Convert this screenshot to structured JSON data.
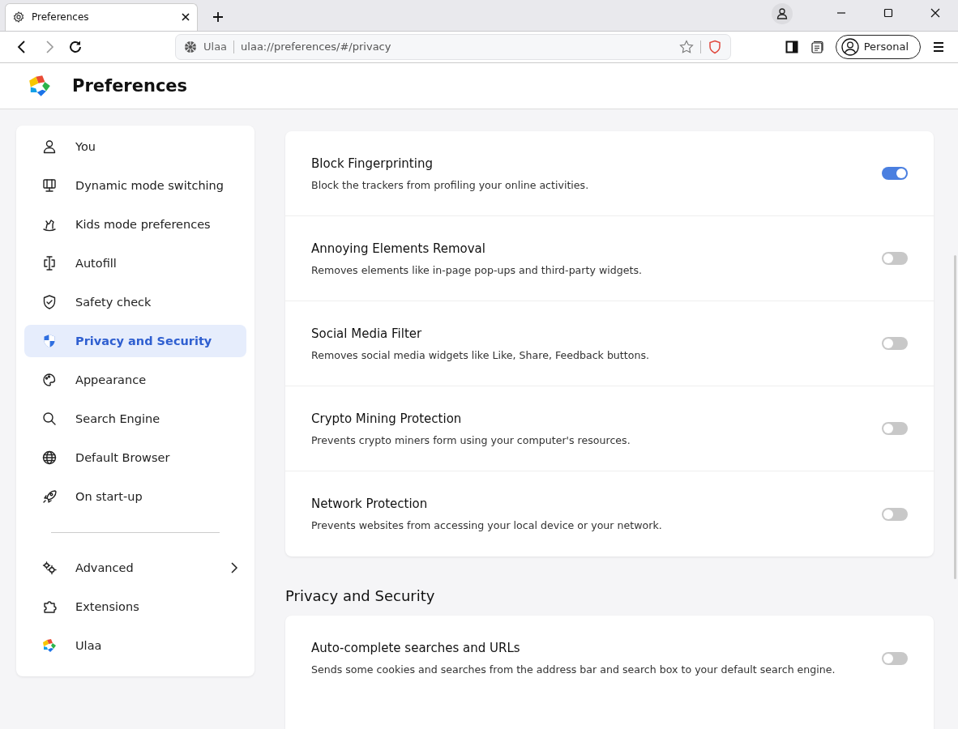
{
  "tab": {
    "title": "Preferences",
    "selected": true
  },
  "address_bar": {
    "site_label": "Ulaa",
    "url": "ulaa://preferences/#/privacy"
  },
  "profile_button": {
    "label": "Personal"
  },
  "header": {
    "title": "Preferences"
  },
  "sidebar": {
    "items": [
      {
        "label": "You",
        "selected": false,
        "has_submenu": false
      },
      {
        "label": "Dynamic mode switching",
        "selected": false,
        "has_submenu": false
      },
      {
        "label": "Kids mode preferences",
        "selected": false,
        "has_submenu": false
      },
      {
        "label": "Autofill",
        "selected": false,
        "has_submenu": false
      },
      {
        "label": "Safety check",
        "selected": false,
        "has_submenu": false
      },
      {
        "label": "Privacy and Security",
        "selected": true,
        "has_submenu": false
      },
      {
        "label": "Appearance",
        "selected": false,
        "has_submenu": false
      },
      {
        "label": "Search Engine",
        "selected": false,
        "has_submenu": false
      },
      {
        "label": "Default Browser",
        "selected": false,
        "has_submenu": false
      },
      {
        "label": "On start-up",
        "selected": false,
        "has_submenu": false
      }
    ],
    "bottom_items": [
      {
        "label": "Advanced",
        "selected": false,
        "has_submenu": true
      },
      {
        "label": "Extensions",
        "selected": false,
        "has_submenu": false
      },
      {
        "label": "Ulaa",
        "selected": false,
        "has_submenu": false
      }
    ]
  },
  "settings": [
    {
      "title": "Block Fingerprinting",
      "description": "Block the trackers from profiling your online activities.",
      "on": true
    },
    {
      "title": "Annoying Elements Removal",
      "description": "Removes elements like in-page pop-ups and third-party widgets.",
      "on": false
    },
    {
      "title": "Social Media Filter",
      "description": "Removes social media widgets like Like, Share, Feedback buttons.",
      "on": false
    },
    {
      "title": "Crypto Mining Protection",
      "description": "Prevents crypto miners form using your computer's resources.",
      "on": false
    },
    {
      "title": "Network Protection",
      "description": "Prevents websites from accessing your local device or your network.",
      "on": false
    }
  ],
  "section": {
    "heading": "Privacy and Security",
    "settings": [
      {
        "title": "Auto-complete searches and URLs",
        "description": "Sends some cookies and searches from the address bar and search box to your default search engine.",
        "on": false
      }
    ]
  }
}
